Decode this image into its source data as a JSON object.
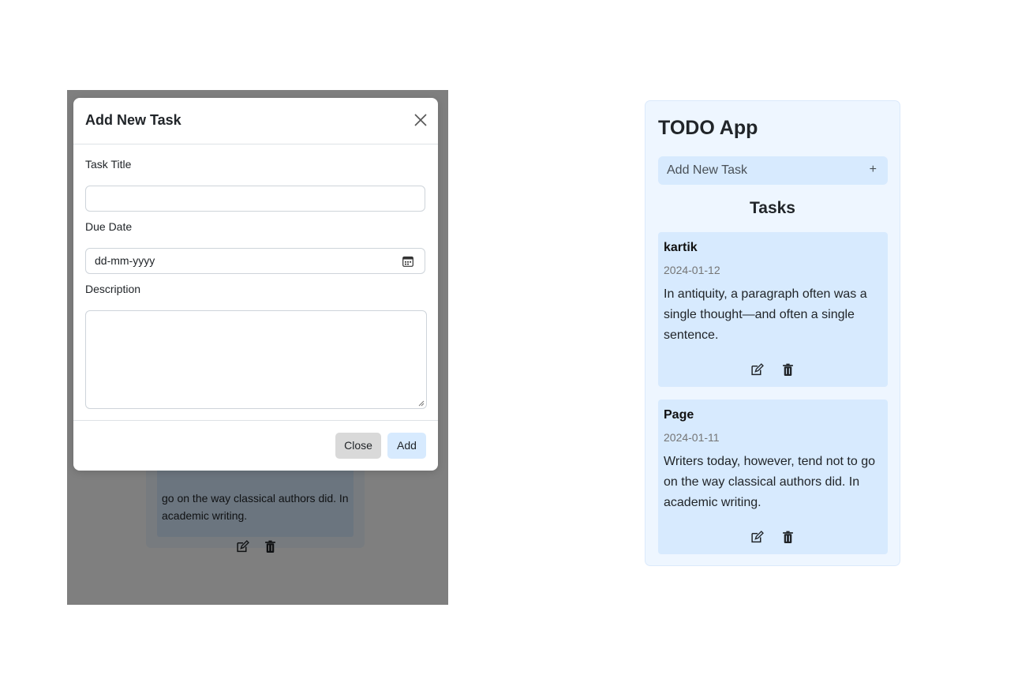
{
  "modal": {
    "title": "Add New Task",
    "fields": {
      "title_label": "Task Title",
      "title_value": "",
      "due_label": "Due Date",
      "due_placeholder": "dd-mm-yyyy",
      "description_label": "Description",
      "description_value": ""
    },
    "buttons": {
      "close": "Close",
      "add": "Add"
    }
  },
  "background_card": {
    "description": "go on the way classical authors did. In academic writing."
  },
  "app": {
    "title": "TODO App",
    "add_bar": {
      "label": "Add New Task",
      "icon": "+"
    },
    "tasks_heading": "Tasks",
    "tasks": [
      {
        "title": "kartik",
        "date": "2024-01-12",
        "description": "In antiquity, a paragraph often was a single thought—and often a single sentence."
      },
      {
        "title": "Page",
        "date": "2024-01-11",
        "description": "Writers today, however, tend not to go on the way classical authors did. In academic writing."
      }
    ]
  },
  "colors": {
    "app_bg": "#eef6ff",
    "card_bg": "#d7eafe",
    "backdrop": "rgba(0,0,0,0.5)",
    "close_button_bg": "#d9d9d9"
  },
  "icons": [
    "close-icon",
    "calendar-icon",
    "resize-handle-icon",
    "edit-icon",
    "trash-icon",
    "plus-icon"
  ]
}
